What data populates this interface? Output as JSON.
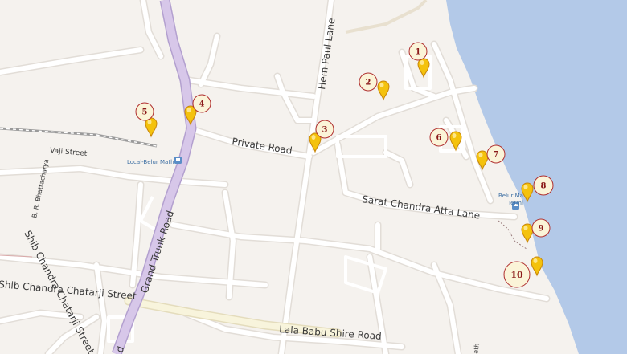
{
  "roads": {
    "hem_paul_lane": "Hem Paul Lane",
    "private_road": "Private Road",
    "vaji_street": "Vaji Street",
    "grand_trunk_road": "Grand Trunk Road",
    "br_bhattacharya": "B. R. Bhattacharya",
    "sarat_chandra_atta_lane": "Sarat Chandra Atta Lane",
    "shib_chandra_chatarji_street": "Shib Chandra Chatarji Street",
    "lala_babu_shire_road": "Lala Babu Shire Road",
    "grand_trunk_road_d": "d",
    "math_fragment": "ath"
  },
  "stations": {
    "local_belur_math": "Local-Belur Math",
    "belur_math_terminal_line1": "Belur Ma",
    "belur_math_terminal_line2": "Termi"
  },
  "markers": [
    {
      "number": "1"
    },
    {
      "number": "2"
    },
    {
      "number": "3"
    },
    {
      "number": "4"
    },
    {
      "number": "5"
    },
    {
      "number": "6"
    },
    {
      "number": "7"
    },
    {
      "number": "8"
    },
    {
      "number": "9"
    },
    {
      "number": "10"
    }
  ],
  "colors": {
    "land": "#f5f2ee",
    "water": "#b3c9e8",
    "road": "#ffffff",
    "road_casing": "#e2ddd7",
    "highway": "#d7c7e9",
    "highway_casing": "#b3a0cf",
    "secondary": "#f8f4dc",
    "railway": "#9a9a9a",
    "marker_fill": "#f4c20d",
    "marker_stroke": "#c8860a",
    "badge_fill": "#fbf4d8",
    "badge_stroke": "#b03030",
    "badge_text": "#8b1a1a"
  }
}
